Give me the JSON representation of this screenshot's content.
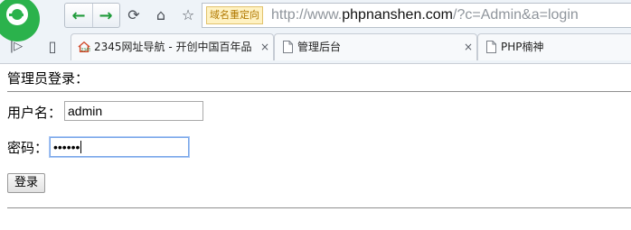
{
  "browser": {
    "redirect_badge": "域名重定向",
    "url_prefix": "http://www.",
    "url_host": "phpnanshen.com",
    "url_path": "/?c=Admin&a=login",
    "tabs": [
      {
        "title": "2345网址导航 - 开创中国百年品",
        "icon": "2345-favicon",
        "close": "×"
      },
      {
        "title": "管理后台",
        "icon": "page-icon",
        "close": "×"
      },
      {
        "title": "PHP楠神",
        "icon": "page-icon"
      }
    ],
    "icons": {
      "back": "←",
      "forward": "→",
      "reload": "⟳",
      "home": "⌂",
      "star": "☆",
      "sidebar": "|▷",
      "device": "▯"
    },
    "accent_color": "#1f9b3a"
  },
  "page": {
    "title": "管理员登录：",
    "username_label": "用户名：",
    "username_value": "admin",
    "password_label": "密码：",
    "password_value": "••••••",
    "submit_label": "登录"
  }
}
